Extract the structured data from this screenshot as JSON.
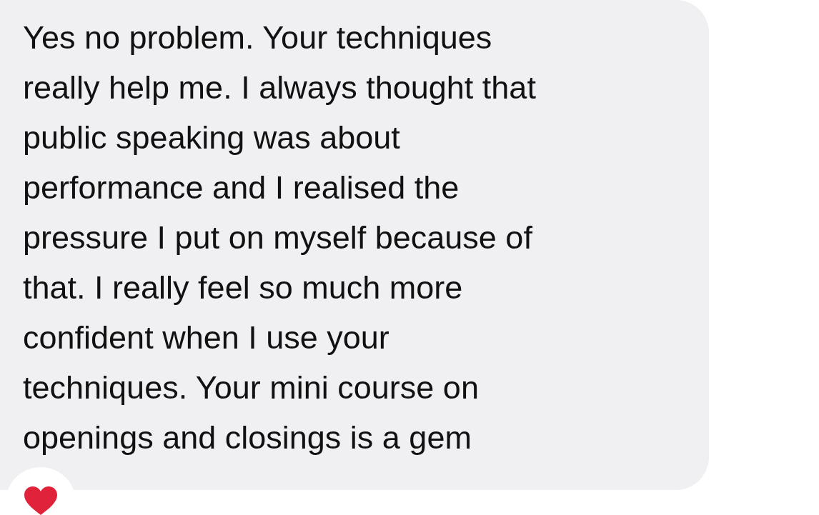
{
  "message": {
    "lines": [
      "Yes no problem. Your techniques",
      "really help me. I always thought that",
      "public speaking was about",
      "performance and I realised the",
      "pressure I put on myself because of",
      "that. I really feel so much more",
      "confident when I use your",
      "techniques. Your mini course on",
      "openings and closings is a gem"
    ],
    "reaction": {
      "kind": "heart"
    }
  }
}
